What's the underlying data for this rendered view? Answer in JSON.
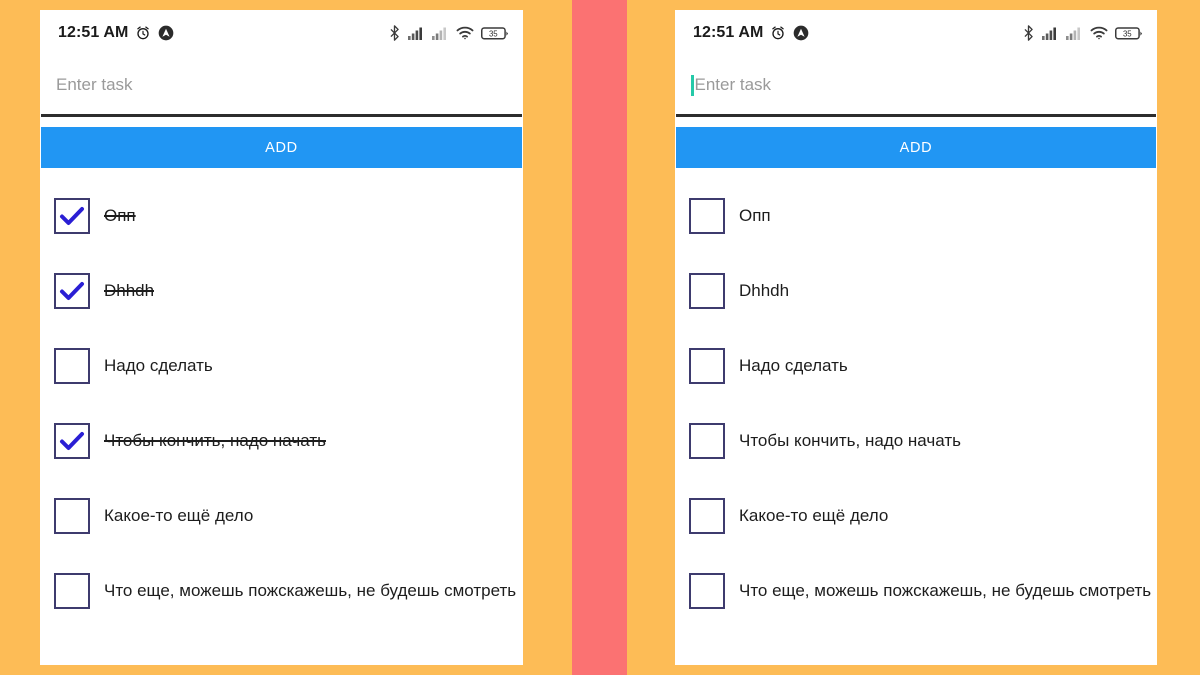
{
  "background": {
    "page_color": "#FDBC56",
    "divider_color": "#FB7272"
  },
  "theme": {
    "accent_blue": "#2196F3",
    "checkbox_border": "#3E3B6E",
    "check_color": "#2A1ED4",
    "caret_color": "#25C9A8",
    "placeholder_color": "#9A9A9A",
    "underline_color": "#2D2D2D"
  },
  "status_bar": {
    "time": "12:51 AM",
    "alarm_icon": "alarm-clock-icon",
    "app_badge_icon": "app-badge-icon",
    "bluetooth_icon": "bluetooth-icon",
    "signal_one_icon": "signal-bars-icon",
    "signal_two_icon": "signal-bars-icon",
    "wifi_icon": "wifi-icon",
    "battery_icon": "battery-icon",
    "battery_level": "35"
  },
  "panels": [
    {
      "id": "left",
      "input": {
        "placeholder": "Enter task",
        "value": "",
        "caret_visible": false
      },
      "add_button": {
        "label": "ADD"
      },
      "tasks": [
        {
          "label": "Опп",
          "checked": true
        },
        {
          "label": "Dhhdh",
          "checked": true
        },
        {
          "label": "Надо сделать",
          "checked": false
        },
        {
          "label": "Чтобы кончить, надо начать",
          "checked": true
        },
        {
          "label": "Какое-то ещё дело",
          "checked": false
        },
        {
          "label": "Что еще, можешь пожскажешь, не будешь смотреть",
          "checked": false
        }
      ]
    },
    {
      "id": "right",
      "input": {
        "placeholder": "Enter task",
        "value": "",
        "caret_visible": true
      },
      "add_button": {
        "label": "ADD"
      },
      "tasks": [
        {
          "label": "Опп",
          "checked": false
        },
        {
          "label": "Dhhdh",
          "checked": false
        },
        {
          "label": "Надо сделать",
          "checked": false
        },
        {
          "label": "Чтобы кончить, надо начать",
          "checked": false
        },
        {
          "label": "Какое-то ещё дело",
          "checked": false
        },
        {
          "label": "Что еще, можешь пожскажешь, не будешь смотреть",
          "checked": false
        }
      ]
    }
  ]
}
